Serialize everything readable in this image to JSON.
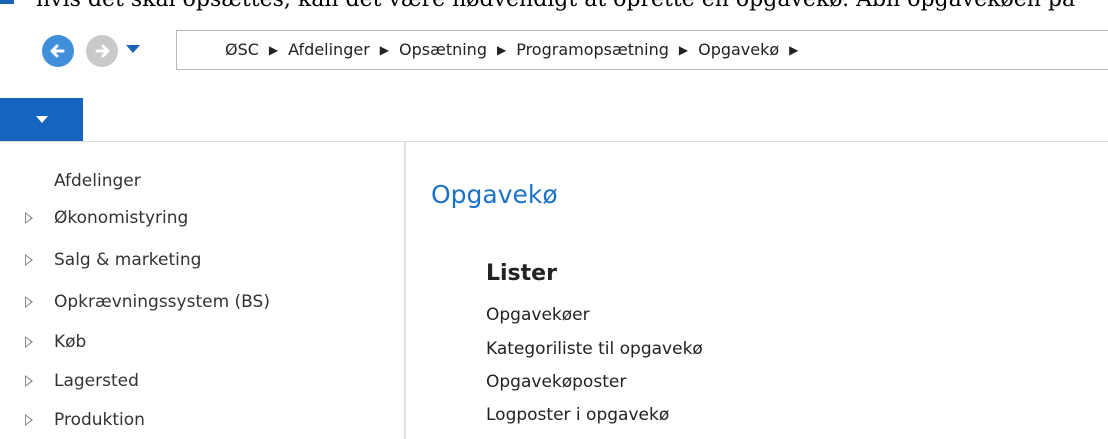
{
  "top_strip": {
    "clipped_text": "hvis det skal opsættes, kan det være nødvendigt at oprette en opgavekø. Åbn opgavekøen på"
  },
  "nav": {
    "breadcrumbs": [
      "ØSC",
      "Afdelinger",
      "Opsætning",
      "Programopsætning",
      "Opgavekø"
    ],
    "separator": "▶"
  },
  "sidebar": {
    "title": "Afdelinger",
    "items": [
      {
        "label": "Økonomistyring"
      },
      {
        "label": "Salg & marketing"
      },
      {
        "label": "Opkrævningssystem (BS)"
      },
      {
        "label": "Køb"
      },
      {
        "label": "Lagersted"
      },
      {
        "label": "Produktion"
      }
    ]
  },
  "main": {
    "title": "Opgavekø",
    "section_title": "Lister",
    "links": [
      {
        "label": "Opgavekøer"
      },
      {
        "label": "Kategoriliste til opgavekø"
      },
      {
        "label": "Opgavekøposter"
      },
      {
        "label": "Logposter i opgavekø"
      }
    ]
  },
  "colors": {
    "accent": "#1a73c9",
    "ribbon": "#1565c0",
    "back_button": "#3f8fdb",
    "forward_button": "#c9c9c9"
  }
}
